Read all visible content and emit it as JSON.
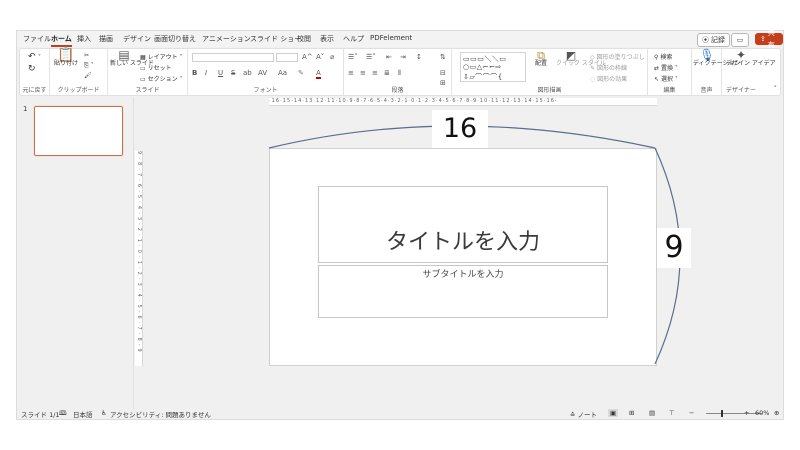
{
  "tabs": [
    "ファイル",
    "ホーム",
    "挿入",
    "描画",
    "デザイン",
    "画面切り替え",
    "アニメーション",
    "スライド ショー",
    "校閲",
    "表示",
    "ヘルプ",
    "PDFelement"
  ],
  "active_tab": "ホーム",
  "header_buttons": {
    "record": "記録",
    "share": "共有"
  },
  "ribbon": {
    "undo_group": {
      "label": "元に戻す"
    },
    "clipboard": {
      "paste": "貼り付け",
      "label": "クリップボード"
    },
    "slides": {
      "new_slide": "新しい スライド",
      "layout": "レイアウト",
      "reset": "リセット",
      "section": "セクション",
      "label": "スライド"
    },
    "font": {
      "label": "フォント",
      "bold": "B",
      "italic": "I",
      "underline": "U",
      "strike": "S",
      "shadow": "ab",
      "spacing": "AV",
      "aa": "Aa",
      "grow": "A^",
      "shrink": "A˅",
      "color": "A"
    },
    "paragraph": {
      "label": "段落"
    },
    "drawing": {
      "arrange": "配置",
      "quick_styles": "クイック スタイル",
      "fill": "図形の塗りつぶし",
      "outline": "図形の枠線",
      "effects": "図形の効果",
      "label": "図形描画"
    },
    "editing": {
      "find": "検索",
      "replace": "置換",
      "select": "選択",
      "label": "編集"
    },
    "voice": {
      "dictate": "ディクテーション",
      "label": "音声"
    },
    "designer": {
      "ideas": "デザイン アイデア",
      "label": "デザイナー"
    }
  },
  "thumbnail": {
    "number": "1"
  },
  "rulers": {
    "horizontal": "·16·15·14·13·12·11·10·9·8·7·6·5·4·3·2·1·0·1·2·3·4·5·6·7·8·9·10·11·12·13·14·15·16·",
    "vertical": "9·8·7·6·5·4·3·2·1·0·1·2·3·4·5·6·7·8·9"
  },
  "slide": {
    "title_placeholder": "タイトルを入力",
    "subtitle_placeholder": "サブタイトルを入力"
  },
  "annotations": {
    "width_label": "16",
    "height_label": "9",
    "line_color": "#5a6e8c"
  },
  "status_bar": {
    "slide_info": "スライド 1/1",
    "language": "日本語",
    "accessibility": "アクセシビリティ: 問題ありません",
    "notes": "ノート",
    "zoom": "60%"
  },
  "colors": {
    "accent": "#c43e1c",
    "thumbnail_border": "#c0744f"
  }
}
